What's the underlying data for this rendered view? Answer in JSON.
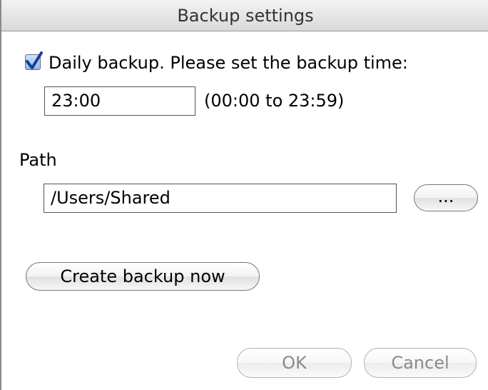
{
  "window": {
    "title": "Backup settings"
  },
  "daily_backup": {
    "checked": true,
    "label": "Daily backup. Please set the backup time:"
  },
  "time_field": {
    "value": "23:00",
    "range_hint": "(00:00 to 23:59)"
  },
  "path": {
    "label": "Path",
    "value": "/Users/Shared",
    "browse_label": "..."
  },
  "actions": {
    "create_backup_label": "Create backup now",
    "ok_label": "OK",
    "cancel_label": "Cancel"
  },
  "colors": {
    "checkbox_fill": "#8fb8ef",
    "check_mark": "#1a3f8a",
    "disabled_text": "#8a8a8a"
  }
}
